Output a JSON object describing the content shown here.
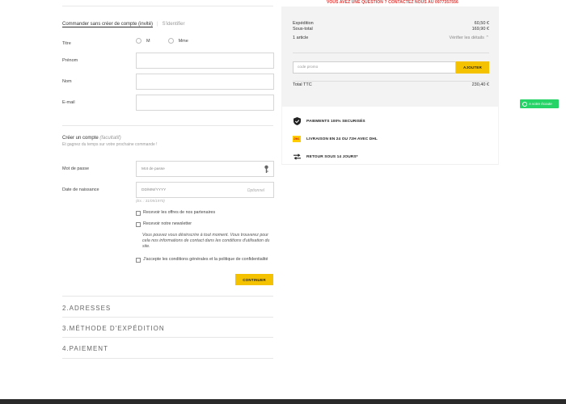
{
  "topbar": {
    "text": "VOUS AVEZ UNE QUESTION ? CONTACTEZ NOUS AU 0977357556"
  },
  "tabs": {
    "guest": "Commander sans créer de compte (invité)",
    "separator": "|",
    "login": "S'identifier"
  },
  "form": {
    "title_label": "Titre",
    "radio_m": "M",
    "radio_mme": "Mme",
    "firstname_label": "Prénom",
    "lastname_label": "Nom",
    "email_label": "E-mail",
    "create_account_title": "Créer un compte",
    "create_account_optional": "(facultatif)",
    "create_account_sub": "Et gagnez du temps sur votre prochaine commande !",
    "password_label": "Mot de passe",
    "password_placeholder": "Mot de passe",
    "birthdate_label": "Date de naissance",
    "birthdate_placeholder": "DD/MM/YYYY",
    "birthdate_optional": "Optionnel",
    "birthdate_hint": "(Ex. : 31/05/1970)",
    "partners_offers": "Recevoir les offres de nos partenaires",
    "newsletter": "Recevoir notre newsletter",
    "note": "Vous pouvez vous désinscrire à tout moment. Vous trouverez pour cela nos informations de contact dans les conditions d'utilisation du site.",
    "terms": "J'accepte les conditions générales et la politique de confidentialité",
    "continue": "CONTINUER"
  },
  "steps": [
    "2.ADRESSES",
    "3.MÉTHODE D'EXPÉDITION",
    "4.PAIEMENT"
  ],
  "summary": {
    "shipping_label": "Expédition",
    "shipping_value": "60,50 €",
    "subtotal_label": "Sous-total",
    "subtotal_value": "169,90 €",
    "items_label": "1 article",
    "details_label": "Vérifier les détails",
    "promo_placeholder": "code promo",
    "promo_button": "AJOUTER",
    "total_label": "Total TTC",
    "total_value": "230,40 €"
  },
  "reassurance": {
    "secure": "PAIEMENTS 100% SECURISÉS",
    "dhl_logo": "DHL",
    "delivery": "LIVRAISON EN 24 OU 72H AVEC DHL",
    "returns": "RETOUR SOUS 14 JOURS*"
  },
  "whatsapp": {
    "label": "A votre écoute"
  },
  "colors": {
    "accent": "#f5c200",
    "whatsapp": "#25d366",
    "topbar": "#e53935"
  }
}
